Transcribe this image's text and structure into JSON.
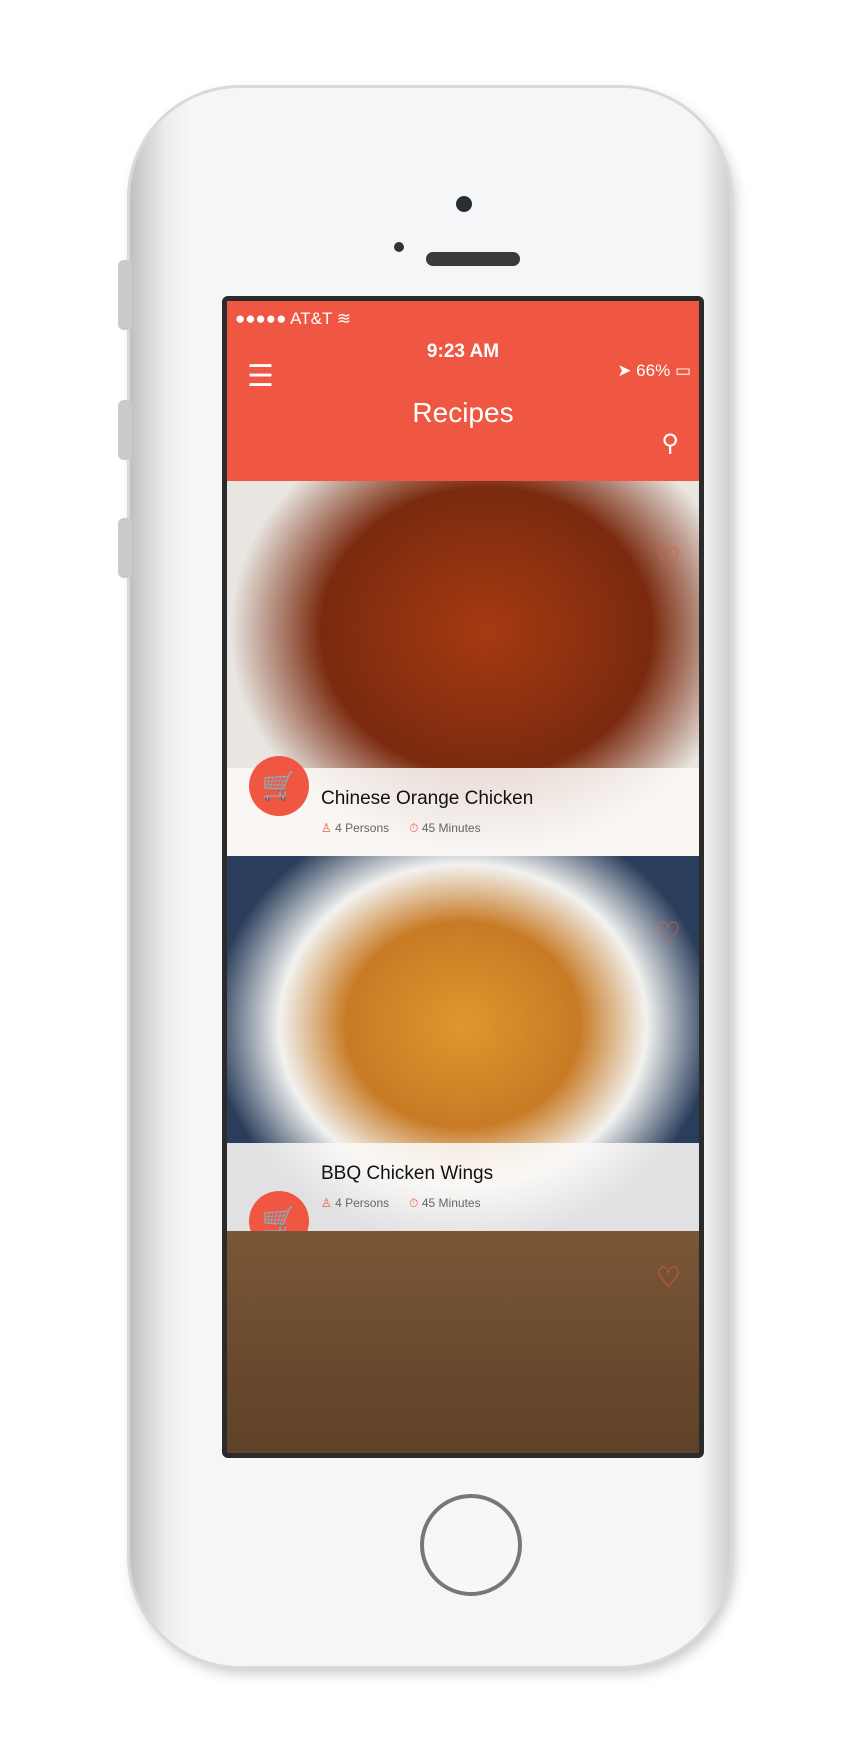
{
  "status": {
    "carrier": "AT&T",
    "time": "9:23 AM",
    "battery": "66%"
  },
  "header": {
    "title": "Recipes"
  },
  "recipes": [
    {
      "name": "Chinese Orange Chicken",
      "persons": "4 Persons",
      "time": "45 Minutes"
    },
    {
      "name": "BBQ Chicken Wings",
      "persons": "4 Persons",
      "time": "45 Minutes"
    }
  ],
  "colors": {
    "accent": "#ef5743"
  }
}
